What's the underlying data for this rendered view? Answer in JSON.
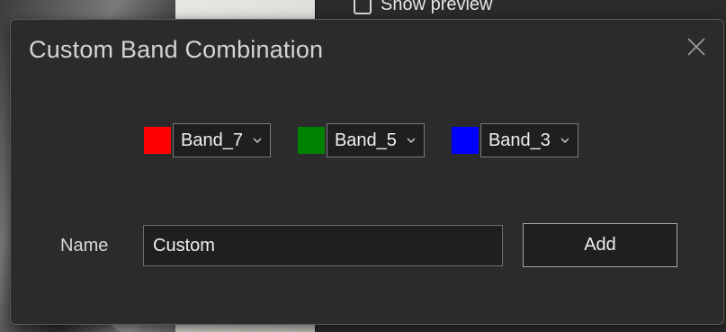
{
  "background": {
    "show_preview_label": "Show preview"
  },
  "dialog": {
    "title": "Custom Band Combination",
    "bands": [
      {
        "channel": "red",
        "color": "#ff0000",
        "value": "Band_7"
      },
      {
        "channel": "green",
        "color": "#008000",
        "value": "Band_5"
      },
      {
        "channel": "blue",
        "color": "#0000ff",
        "value": "Band_3"
      }
    ],
    "name_label": "Name",
    "name_value": "Custom",
    "add_label": "Add"
  },
  "icons": {
    "close": "close-icon",
    "dropdown": "chevron-down-icon"
  }
}
